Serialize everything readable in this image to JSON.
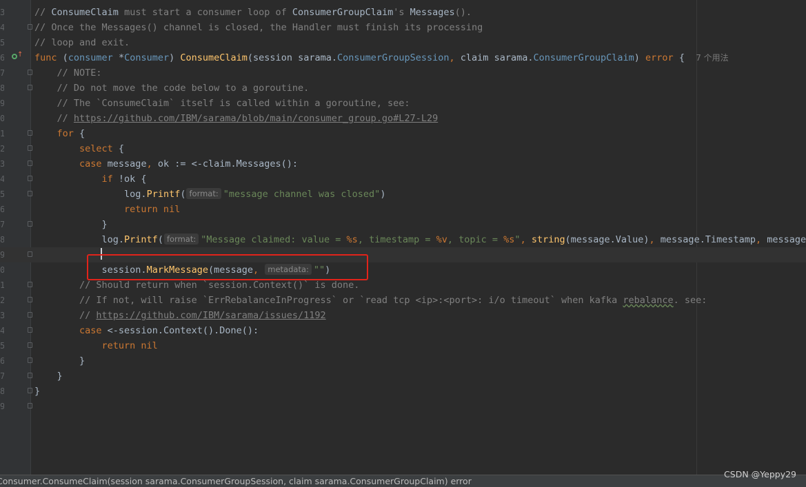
{
  "editor": {
    "lines": [
      {
        "n": "3",
        "tokens": [
          {
            "c": "c",
            "t": "// "
          },
          {
            "c": "p",
            "t": "ConsumeClaim"
          },
          {
            "c": "c",
            "t": " must start a consumer loop of "
          },
          {
            "c": "p",
            "t": "ConsumerGroupClaim"
          },
          {
            "c": "c",
            "t": "'s "
          },
          {
            "c": "p",
            "t": "Messages"
          },
          {
            "c": "c",
            "t": "()."
          }
        ]
      },
      {
        "n": "4",
        "tokens": [
          {
            "c": "c",
            "t": "// Once the Messages() channel is closed, the Handler must finish its processing"
          }
        ]
      },
      {
        "n": "5",
        "tokens": [
          {
            "c": "c",
            "t": "// loop and exit."
          }
        ]
      },
      {
        "n": "6",
        "tokens": [
          {
            "c": "k",
            "t": "func "
          },
          {
            "c": "p",
            "t": "("
          },
          {
            "c": "t",
            "t": "consumer "
          },
          {
            "c": "p",
            "t": "*"
          },
          {
            "c": "t",
            "t": "Consumer"
          },
          {
            "c": "p",
            "t": ") "
          },
          {
            "c": "f",
            "t": "ConsumeClaim"
          },
          {
            "c": "p",
            "t": "(session sarama."
          },
          {
            "c": "t",
            "t": "ConsumerGroupSession"
          },
          {
            "c": "k",
            "t": ", "
          },
          {
            "c": "p",
            "t": "claim sarama."
          },
          {
            "c": "t",
            "t": "ConsumerGroupClaim"
          },
          {
            "c": "p",
            "t": ") "
          },
          {
            "c": "k",
            "t": "error"
          },
          {
            "c": "p",
            "t": " {  "
          },
          {
            "c": "usage",
            "t": "7 个用法"
          }
        ]
      },
      {
        "n": "7",
        "tokens": [
          {
            "c": "c",
            "t": "    // NOTE:"
          }
        ]
      },
      {
        "n": "8",
        "tokens": [
          {
            "c": "c",
            "t": "    // Do not move the code below to a goroutine."
          }
        ]
      },
      {
        "n": "9",
        "tokens": [
          {
            "c": "c",
            "t": "    // The `ConsumeClaim` itself is called within a goroutine, see:"
          }
        ]
      },
      {
        "n": "0",
        "tokens": [
          {
            "c": "c",
            "t": "    // "
          },
          {
            "c": "u",
            "t": "https://github.com/IBM/sarama/blob/main/consumer_group.go#L27-L29"
          }
        ]
      },
      {
        "n": "1",
        "tokens": [
          {
            "c": "k",
            "t": "    for"
          },
          {
            "c": "p",
            "t": " {"
          }
        ]
      },
      {
        "n": "2",
        "tokens": [
          {
            "c": "k",
            "t": "        select"
          },
          {
            "c": "p",
            "t": " {"
          }
        ]
      },
      {
        "n": "3",
        "tokens": [
          {
            "c": "k",
            "t": "        case "
          },
          {
            "c": "p",
            "t": "message"
          },
          {
            "c": "k",
            "t": ", "
          },
          {
            "c": "p",
            "t": "ok := <-claim."
          },
          {
            "c": "m",
            "t": "Messages"
          },
          {
            "c": "p",
            "t": "():"
          }
        ]
      },
      {
        "n": "4",
        "tokens": [
          {
            "c": "k",
            "t": "            if "
          },
          {
            "c": "p",
            "t": "!ok {"
          }
        ]
      },
      {
        "n": "5",
        "tokens": [
          {
            "c": "p",
            "t": "                log."
          },
          {
            "c": "f",
            "t": "Printf"
          },
          {
            "c": "p",
            "t": "("
          },
          {
            "c": "hint",
            "t": "format:"
          },
          {
            "c": "s",
            "t": "\"message channel was closed\""
          },
          {
            "c": "p",
            "t": ")"
          }
        ]
      },
      {
        "n": "6",
        "tokens": [
          {
            "c": "k",
            "t": "                return nil"
          }
        ]
      },
      {
        "n": "7",
        "tokens": [
          {
            "c": "p",
            "t": "            }"
          }
        ]
      },
      {
        "n": "8",
        "tokens": [
          {
            "c": "p",
            "t": "            log."
          },
          {
            "c": "f",
            "t": "Printf"
          },
          {
            "c": "p",
            "t": "("
          },
          {
            "c": "hint",
            "t": "format:"
          },
          {
            "c": "s",
            "t": "\"Message claimed: value = "
          },
          {
            "c": "fmt",
            "t": "%s"
          },
          {
            "c": "s",
            "t": ", timestamp = "
          },
          {
            "c": "fmt",
            "t": "%v"
          },
          {
            "c": "s",
            "t": ", topic = "
          },
          {
            "c": "fmt",
            "t": "%s"
          },
          {
            "c": "s",
            "t": "\""
          },
          {
            "c": "k",
            "t": ", "
          },
          {
            "c": "f",
            "t": "string"
          },
          {
            "c": "p",
            "t": "(message.Value)"
          },
          {
            "c": "k",
            "t": ", "
          },
          {
            "c": "p",
            "t": "message.Timestamp"
          },
          {
            "c": "k",
            "t": ", "
          },
          {
            "c": "p",
            "t": "message.T"
          }
        ]
      },
      {
        "n": "9",
        "current": true,
        "tokens": []
      },
      {
        "n": "0",
        "tokens": [
          {
            "c": "p",
            "t": "            session."
          },
          {
            "c": "f",
            "t": "MarkMessage"
          },
          {
            "c": "p",
            "t": "(message"
          },
          {
            "c": "k",
            "t": ", "
          },
          {
            "c": "hint",
            "t": "metadata:"
          },
          {
            "c": "s",
            "t": "\"\""
          },
          {
            "c": "p",
            "t": ")"
          }
        ]
      },
      {
        "n": "1",
        "tokens": [
          {
            "c": "c",
            "t": "        // Should return when `session.Context()` is done."
          }
        ]
      },
      {
        "n": "2",
        "tokens": [
          {
            "c": "c",
            "t": "        // If not, will raise `ErrRebalanceInProgress` or `read tcp <ip>:<port>: i/o timeout` when kafka "
          },
          {
            "c": "c squig",
            "t": "rebalance"
          },
          {
            "c": "c",
            "t": ". see:"
          }
        ]
      },
      {
        "n": "3",
        "tokens": [
          {
            "c": "c",
            "t": "        // "
          },
          {
            "c": "u",
            "t": "https://github.com/IBM/sarama/issues/1192"
          }
        ]
      },
      {
        "n": "4",
        "tokens": [
          {
            "c": "k",
            "t": "        case "
          },
          {
            "c": "p",
            "t": "<-session."
          },
          {
            "c": "m",
            "t": "Context"
          },
          {
            "c": "p",
            "t": "()."
          },
          {
            "c": "m",
            "t": "Done"
          },
          {
            "c": "p",
            "t": "():"
          }
        ]
      },
      {
        "n": "5",
        "tokens": [
          {
            "c": "k",
            "t": "            return nil"
          }
        ]
      },
      {
        "n": "6",
        "tokens": [
          {
            "c": "p",
            "t": "        }"
          }
        ]
      },
      {
        "n": "7",
        "tokens": [
          {
            "c": "p",
            "t": "    }"
          }
        ]
      },
      {
        "n": "8",
        "tokens": [
          {
            "c": "p",
            "t": "}"
          }
        ]
      },
      {
        "n": "9",
        "tokens": []
      }
    ],
    "fold_markers": [
      1,
      4,
      5,
      8,
      9,
      10,
      11,
      12,
      14,
      16,
      18,
      19,
      20,
      21,
      22,
      23,
      24,
      25,
      26
    ]
  },
  "status_bar": {
    "text": "Consumer.ConsumeClaim(session sarama.ConsumerGroupSession, claim sarama.ConsumerGroupClaim) error"
  },
  "watermark": "CSDN @Yeppy29",
  "colors": {
    "background": "#2b2b2b",
    "highlight_box": "#e2231a",
    "keyword": "#cc7832",
    "function": "#ffc66d",
    "string": "#6a8759",
    "comment": "#808080"
  }
}
